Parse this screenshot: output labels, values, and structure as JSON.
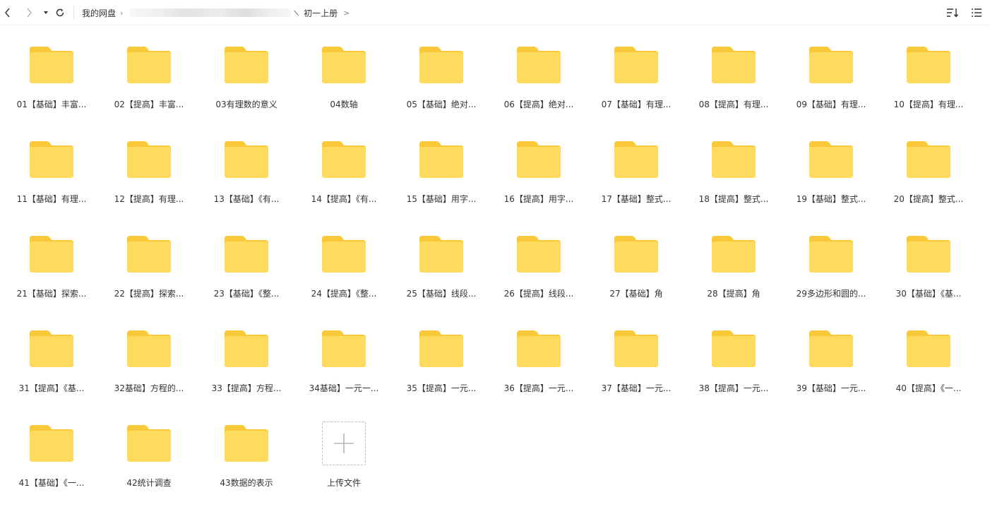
{
  "toolbar": {
    "icons": [
      "chevron-left-icon",
      "chevron-right-icon",
      "caret-down-icon",
      "refresh-icon",
      "sort-icon",
      "list-view-icon"
    ]
  },
  "breadcrumb": {
    "root": "我的网盘",
    "current": "初一上册"
  },
  "folders": [
    "01【基础】丰富...",
    "02【提高】丰富...",
    "03有理数的意义",
    "04数轴",
    "05【基础】绝对...",
    "06【提高】绝对...",
    "07【基础】有理...",
    "08【提高】有理...",
    "09【基础】有理...",
    "10【提高】有理...",
    "11【基础】有理...",
    "12【提高】有理...",
    "13【基础】《有...",
    "14【提高】《有...",
    "15【基础】用字...",
    "16【提高】用字...",
    "17【基础】整式...",
    "18【提高】整式...",
    "19【基础】整式...",
    "20【提高】整式...",
    "21【基础】探索...",
    "22【提高】探索...",
    "23【基础】《整...",
    "24【提高】《整...",
    "25【基础】线段...",
    "26【提高】线段...",
    "27【基础】角",
    "28【提高】角",
    "29多边形和圆的...",
    "30【基础】《基...",
    "31【提高】《基...",
    "32基础】方程的...",
    "33【提高】方程...",
    "34基础】一元一...",
    "35【提高】一元...",
    "36【提高】一元...",
    "37【基础】一元...",
    "38【提高】一元...",
    "39【基础】一元...",
    "40【提高】《一...",
    "41【基础】《一...",
    "42统计调查",
    "43数据的表示"
  ],
  "upload": {
    "label": "上传文件",
    "icon": "plus-icon"
  },
  "colors": {
    "folder_back": "#f9c93a",
    "folder_front": "#fedb5c",
    "text": "#333333"
  }
}
